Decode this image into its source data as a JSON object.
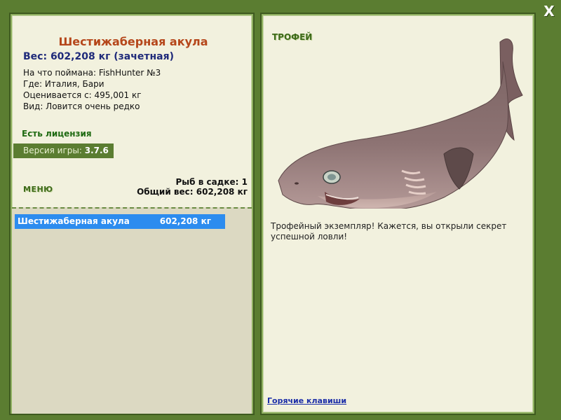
{
  "window": {
    "close_label": "X"
  },
  "left": {
    "fish_title": "Шестижаберная акула",
    "weight_line": "Вес: 602,208 кг (зачетная)",
    "info": [
      "На что поймана: FishHunter №3",
      "Где: Италия, Бари",
      "Оценивается с: 495,001 кг",
      "Вид: Ловится очень редко"
    ],
    "license": "Есть лицензия",
    "version_label": "Версия игры:",
    "version_value": "3.7.6",
    "menu_label": "МЕНЮ",
    "stats": {
      "fish_in_net": "Рыб в садке: 1",
      "total_weight": "Общий вес: 602,208 кг"
    },
    "list": [
      {
        "name": "Шестижаберная акула",
        "weight": "602,208 кг"
      }
    ]
  },
  "right": {
    "trophy_label": "ТРОФЕЙ",
    "description": "Трофейный экземпляр! Кажется, вы открыли секрет успешной ловли!",
    "hotkeys_label": "Горячие клавиши"
  },
  "colors": {
    "frame": "#5b7d31",
    "panel": "#f2f1de",
    "list_bg": "#dcd9c2",
    "selection": "#2c8cef",
    "title": "#b5461a",
    "weight": "#1f2a7a"
  }
}
